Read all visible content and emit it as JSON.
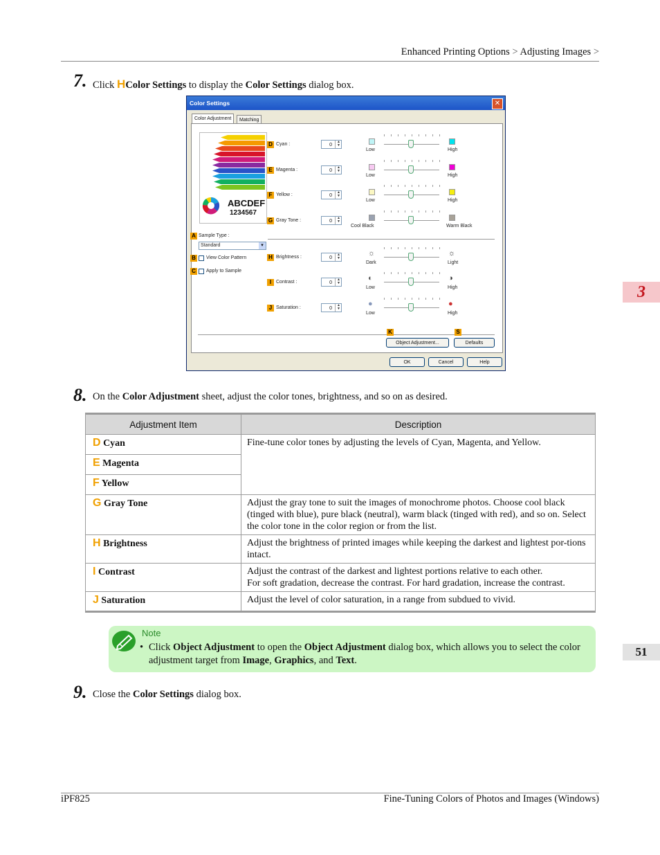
{
  "header": {
    "breadcrumb_1": "Enhanced Printing Options",
    "sep": ">",
    "breadcrumb_2": "Adjusting Images",
    "sep2": ">"
  },
  "side_tab": "3",
  "page_number": "51",
  "step7": {
    "num": "7.",
    "pre": "Click",
    "letter": "H",
    "bold1": "Color Settings",
    "mid": "to display the",
    "bold2": "Color Settings",
    "post": "dialog box."
  },
  "dialog": {
    "title": "Color Settings",
    "close": "✕",
    "tabs": [
      "Color Adjustment",
      "Matching"
    ],
    "preview": {
      "line1": "ABCDEF",
      "line2": "1234567"
    },
    "rows": [
      {
        "letter": "D",
        "label": "Cyan :",
        "value": "0",
        "low": "Low",
        "high": "High",
        "low_color": "#bff4f6",
        "high_color": "#00e4ee"
      },
      {
        "letter": "E",
        "label": "Magenta :",
        "value": "0",
        "low": "Low",
        "high": "High",
        "low_color": "#f7c9f1",
        "high_color": "#f000d6"
      },
      {
        "letter": "F",
        "label": "Yellow :",
        "value": "0",
        "low": "Low",
        "high": "High",
        "low_color": "#fbf7c2",
        "high_color": "#f5ee10"
      },
      {
        "letter": "G",
        "label": "Gray Tone :",
        "value": "0",
        "low": "Cool Black",
        "high": "Warm Black",
        "low_color": "#9aa2b0",
        "high_color": "#a8a298"
      },
      {
        "letter": "H",
        "label": "Brightness :",
        "value": "0",
        "low": "Dark",
        "high": "Light",
        "low_icon": "☼",
        "high_icon": "☼"
      },
      {
        "letter": "I",
        "label": "Contrast :",
        "value": "0",
        "low": "Low",
        "high": "High",
        "low_icon": "◐",
        "high_icon": "◑"
      },
      {
        "letter": "J",
        "label": "Saturation :",
        "value": "0",
        "low": "Low",
        "high": "High",
        "low_icon": "●",
        "high_icon": "●"
      }
    ],
    "sample_type": {
      "letter": "A",
      "label": "Sample Type :",
      "value": "Standard"
    },
    "view_color_pattern": {
      "letter": "B",
      "label": "View Color Pattern"
    },
    "apply_to_sample": {
      "letter": "C",
      "label": "Apply to Sample"
    },
    "object_adjustment": {
      "letter": "K",
      "label": "Object Adjustment..."
    },
    "defaults": {
      "letter": "S",
      "label": "Defaults"
    },
    "ok": "OK",
    "cancel": "Cancel",
    "help": "Help"
  },
  "step8": {
    "num": "8.",
    "pre": "On the",
    "bold": "Color Adjustment",
    "post": "sheet, adjust the color tones, brightness, and so on as desired."
  },
  "table": {
    "headers": [
      "Adjustment Item",
      "Description"
    ],
    "rows": [
      {
        "letter": "D",
        "item": "Cyan",
        "desc": "Fine-tune color tones by adjusting the levels of Cyan, Magenta, and Yellow."
      },
      {
        "letter": "E",
        "item": "Magenta"
      },
      {
        "letter": "F",
        "item": "Yellow"
      },
      {
        "letter": "G",
        "item": "Gray Tone",
        "desc": "Adjust the gray tone to suit the images of monochrome photos. Choose cool black (tinged with blue), pure black (neutral), warm black (tinged with red), and so on. Select the color tone in the color region or from the list."
      },
      {
        "letter": "H",
        "item": "Brightness",
        "desc": "Adjust the brightness of printed images while keeping the darkest and lightest por-tions intact."
      },
      {
        "letter": "I",
        "item": "Contrast",
        "desc": "Adjust the contrast of the darkest and lightest portions relative to each other.",
        "desc2": "For soft gradation, decrease the contrast. For hard gradation, increase the contrast."
      },
      {
        "letter": "J",
        "item": "Saturation",
        "desc": "Adjust the level of color saturation, in a range from subdued to vivid."
      }
    ]
  },
  "note": {
    "title": "Note",
    "bullet": "•",
    "t1": "Click",
    "b1": "Object Adjustment",
    "t2": "to open the",
    "b2": "Object Adjustment",
    "t3": "dialog box, which allows you to select the color adjustment target from",
    "b3": "Image",
    "t4": ",",
    "b4": "Graphics",
    "t5": ", and",
    "b5": "Text",
    "t6": "."
  },
  "step9": {
    "num": "9.",
    "pre": "Close the",
    "bold": "Color Settings",
    "post": "dialog box."
  },
  "footer": {
    "left": "iPF825",
    "right": "Fine-Tuning Colors of Photos and Images (Windows)"
  }
}
